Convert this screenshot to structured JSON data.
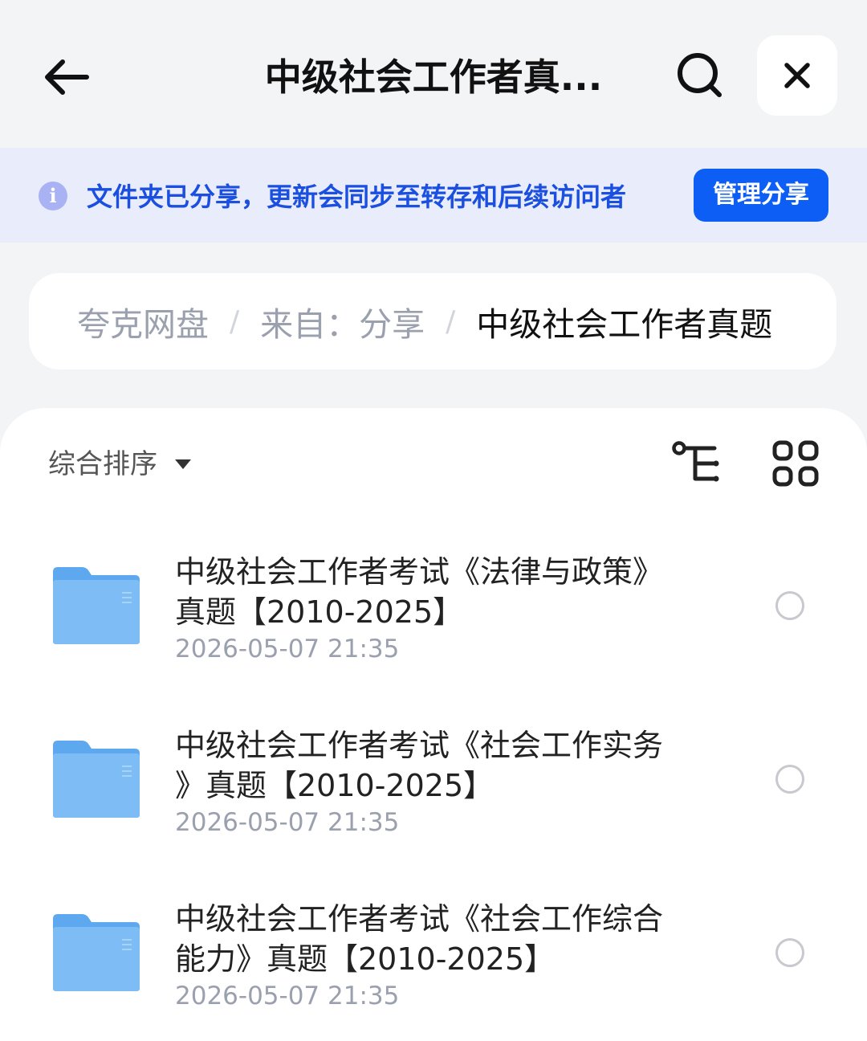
{
  "header": {
    "title": "中级社会工作者真...",
    "back_icon": "arrow-left-icon",
    "search_icon": "search-icon",
    "close_icon": "close-icon"
  },
  "banner": {
    "icon": "info-icon",
    "icon_glyph": "i",
    "text": "文件夹已分享，更新会同步至转存和后续访问者",
    "button_label": "管理分享"
  },
  "breadcrumb": {
    "items": [
      "夸克网盘",
      "来自：分享",
      "中级社会工作者真题"
    ],
    "separator": "/"
  },
  "toolbar": {
    "sort_label": "综合排序",
    "tree_icon": "tree-view-icon",
    "grid_icon": "grid-view-icon"
  },
  "files": [
    {
      "name_line1": "中级社会工作者考试《法律与政策》",
      "name_line2": "真题【2010-2025】",
      "date": "2026-05-07 21:35",
      "icon": "folder-icon"
    },
    {
      "name_line1": "中级社会工作者考试《社会工作实务",
      "name_line2": "》真题【2010-2025】",
      "date": "2026-05-07 21:35",
      "icon": "folder-icon"
    },
    {
      "name_line1": "中级社会工作者考试《社会工作综合",
      "name_line2": "能力》真题【2010-2025】",
      "date": "2026-05-07 21:35",
      "icon": "folder-icon"
    }
  ],
  "colors": {
    "accent": "#0d5ef5",
    "banner_text": "#1a4fe0",
    "banner_bg": "#e9ecfb",
    "folder_blue": "#6fb2f2"
  }
}
